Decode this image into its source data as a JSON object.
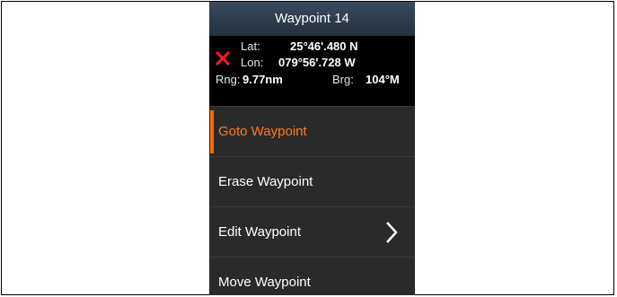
{
  "waypoint": {
    "title": "Waypoint 14",
    "lat_label": "Lat:",
    "lat_value": "25°46'.480 N",
    "lon_label": "Lon:",
    "lon_value": "079°56'.728 W",
    "rng_label": "Rng:",
    "rng_value": "9.77nm",
    "brg_label": "Brg:",
    "brg_value": "104°M"
  },
  "menu": {
    "items": [
      {
        "label": "Goto Waypoint",
        "active": true
      },
      {
        "label": "Erase Waypoint"
      },
      {
        "label": "Edit Waypoint",
        "submenu": true
      },
      {
        "label": "Move Waypoint"
      }
    ]
  },
  "icons": {
    "waypoint_marker": "close-x-icon",
    "submenu": "chevron-right-icon"
  },
  "colors": {
    "accent": "#ff6a00",
    "header": "#2c3c4e",
    "marker": "#ff1a1a"
  }
}
